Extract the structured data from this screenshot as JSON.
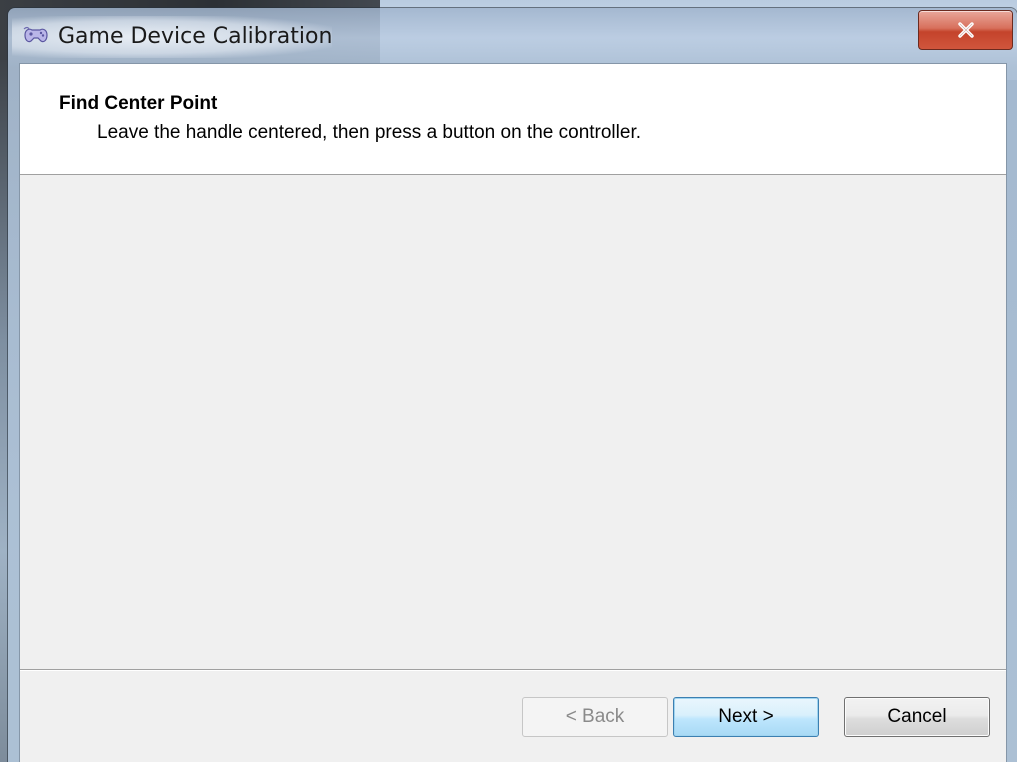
{
  "window": {
    "title": "Game Device Calibration",
    "icon": "gamepad-icon",
    "close_icon": "close-icon"
  },
  "header": {
    "title": "Find Center Point",
    "subtitle": "Leave the handle centered, then press a button on the controller."
  },
  "buttons": {
    "back_label": "< Back",
    "back_enabled": false,
    "next_label": "Next >",
    "cancel_label": "Cancel"
  },
  "colors": {
    "close_button": "#c4432b",
    "next_button_border": "#3c7fb1",
    "client_background": "#f0f0f0"
  }
}
